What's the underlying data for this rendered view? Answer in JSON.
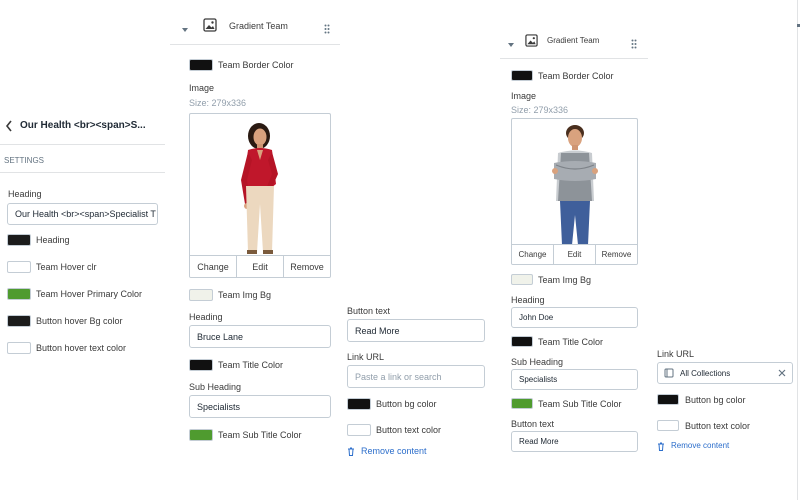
{
  "panel1": {
    "back_title": "Our Health <br><span>S...",
    "settings_label": "SETTINGS",
    "heading_label": "Heading",
    "heading_value": "Our Health <br><span>Specialist T",
    "colors": [
      {
        "label": "Heading",
        "hex": "#1c1c1c"
      },
      {
        "label": "Team Hover clr",
        "hex": "#ffffff"
      },
      {
        "label": "Team Hover Primary Color",
        "hex": "#4f9b2f"
      },
      {
        "label": "Button hover Bg color",
        "hex": "#1c1c1c"
      },
      {
        "label": "Button hover text color",
        "hex": "#ffffff"
      }
    ]
  },
  "panel2": {
    "block_title": "Gradient Team",
    "border_color_label": "Team Border Color",
    "border_color_hex": "#111111",
    "image_label": "Image",
    "image_size": "Size: 279x336",
    "image_buttons": [
      "Change",
      "Edit",
      "Remove"
    ],
    "img_bg_label": "Team Img Bg",
    "img_bg_hex": "#f0f2ea",
    "heading_label": "Heading",
    "heading_value": "Bruce Lane",
    "title_color_label": "Team Title Color",
    "title_color_hex": "#111111",
    "subheading_label": "Sub Heading",
    "subheading_value": "Specialists",
    "subtitle_color_label": "Team Sub Title Color",
    "subtitle_color_hex": "#4f9b2f"
  },
  "panel2b": {
    "button_text_label": "Button text",
    "button_text_value": "Read More",
    "link_url_label": "Link URL",
    "link_url_placeholder": "Paste a link or search",
    "button_bg_label": "Button bg color",
    "button_bg_hex": "#111111",
    "button_text_color_label": "Button text color",
    "button_text_color_hex": "#ffffff",
    "remove_label": "Remove content"
  },
  "panel3": {
    "block_title": "Gradient Team",
    "border_color_label": "Team Border Color",
    "border_color_hex": "#111111",
    "image_label": "Image",
    "image_size": "Size: 279x336",
    "image_buttons": [
      "Change",
      "Edit",
      "Remove"
    ],
    "img_bg_label": "Team Img Bg",
    "img_bg_hex": "#f0f2ea",
    "heading_label": "Heading",
    "heading_value": "John Doe",
    "title_color_label": "Team Title Color",
    "title_color_hex": "#111111",
    "subheading_label": "Sub Heading",
    "subheading_value": "Specialists",
    "subtitle_color_label": "Team Sub Title Color",
    "subtitle_color_hex": "#4f9b2f",
    "button_text_label": "Button text",
    "button_text_value": "Read More"
  },
  "panel3b": {
    "link_url_label": "Link URL",
    "link_value": "All Collections",
    "button_bg_label": "Button bg color",
    "button_bg_hex": "#111111",
    "button_text_color_label": "Button text color",
    "button_text_color_hex": "#ffffff",
    "remove_label": "Remove content"
  }
}
